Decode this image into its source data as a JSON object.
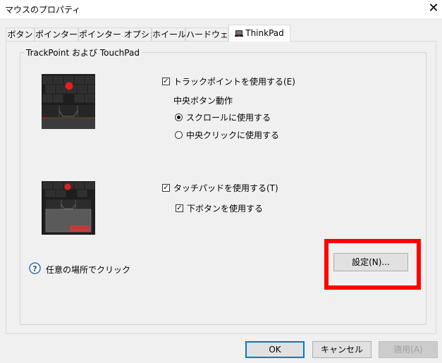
{
  "window": {
    "title": "マウスのプロパティ"
  },
  "tabs": [
    {
      "label": "ボタン"
    },
    {
      "label": "ポインター"
    },
    {
      "label": "ポインター オプション"
    },
    {
      "label": "ホイール"
    },
    {
      "label": "ハードウェア"
    },
    {
      "label": "ThinkPad",
      "active": true
    }
  ],
  "group": {
    "label": "TrackPoint および TouchPad"
  },
  "trackpoint": {
    "enable_label": "トラックポイントを使用する(E)",
    "enable_checked": true,
    "middle_button_heading": "中央ボタン動作",
    "options": [
      {
        "label": "スクロールに使用する",
        "selected": true
      },
      {
        "label": "中央クリックに使用する",
        "selected": false
      }
    ]
  },
  "touchpad": {
    "enable_label": "タッチパッドを使用する(T)",
    "enable_checked": true,
    "lower_buttons_label": "下ボタンを使用する",
    "lower_buttons_checked": true
  },
  "help": {
    "text": "任意の場所でクリック",
    "icon": "help-question-icon"
  },
  "settings_button": {
    "label": "設定(N)..."
  },
  "footer": {
    "ok_label": "OK",
    "cancel_label": "キャンセル",
    "apply_label": "適用(A)"
  },
  "colors": {
    "highlight_red": "#ff0000",
    "trackpoint_red": "#e02020",
    "accent_blue": "#0078d7"
  }
}
